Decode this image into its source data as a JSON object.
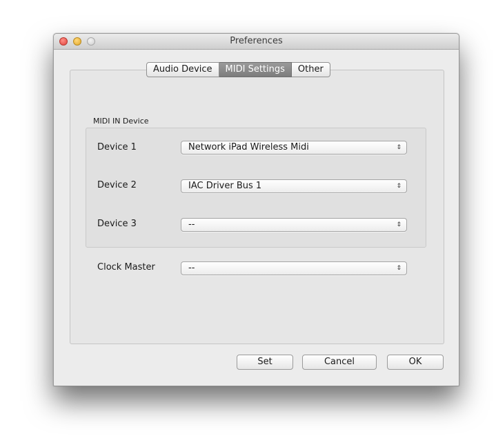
{
  "window": {
    "title": "Preferences"
  },
  "tabs": [
    {
      "label": "Audio Device",
      "active": false
    },
    {
      "label": "MIDI Settings",
      "active": true
    },
    {
      "label": "Other",
      "active": false
    }
  ],
  "midi_in": {
    "group_label": "MIDI IN Device",
    "devices": [
      {
        "label": "Device 1",
        "value": "Network iPad Wireless Midi"
      },
      {
        "label": "Device 2",
        "value": "IAC Driver Bus 1"
      },
      {
        "label": "Device 3",
        "value": "--"
      }
    ]
  },
  "clock_master": {
    "label": "Clock Master",
    "value": "--"
  },
  "buttons": {
    "set": "Set",
    "cancel": "Cancel",
    "ok": "OK"
  },
  "icons": {
    "popup_arrows": "⇕"
  }
}
